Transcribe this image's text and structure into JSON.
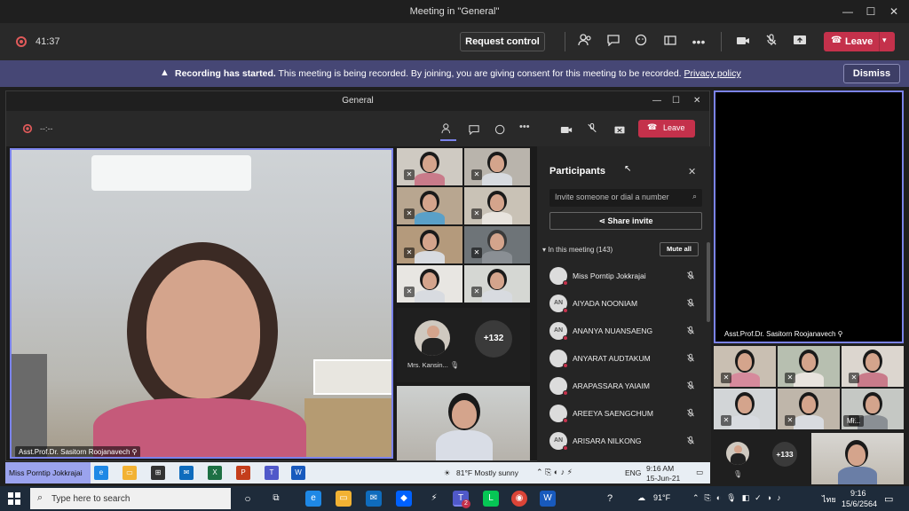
{
  "window": {
    "title": "Meeting in \"General\"",
    "minimize": "—",
    "maximize": "☐",
    "close": "✕"
  },
  "meeting_bar": {
    "elapsed": "41:37",
    "request_control": "Request control",
    "leave": "Leave"
  },
  "banner": {
    "bold": "Recording has started.",
    "text": " This meeting is being recorded. By joining, you are giving consent for this meeting to be recorded. ",
    "link": "Privacy policy",
    "dismiss": "Dismiss"
  },
  "inner": {
    "title": "General",
    "timer": "--:--",
    "leave": "Leave",
    "main_speaker": "Asst.Prof.Dr. Sasitorn Roojanavech",
    "kansin": "Mrs. Kansin...",
    "overflow": "+132"
  },
  "panel": {
    "title": "Participants",
    "search_placeholder": "Invite someone or dial a number",
    "share_invite": "Share invite",
    "section": "In this meeting (143)",
    "mute_all": "Mute all",
    "participants": [
      {
        "initials": "",
        "name": "Miss Porntip Jokkrajai"
      },
      {
        "initials": "AN",
        "name": "AIYADA NOONIAM"
      },
      {
        "initials": "AN",
        "name": "ANANYA NUANSAENG"
      },
      {
        "initials": "",
        "name": "ANYARAT AUDTAKUM"
      },
      {
        "initials": "",
        "name": "ARAPASSARA YAIAIM"
      },
      {
        "initials": "",
        "name": "AREEYA SAENGCHUM"
      },
      {
        "initials": "AN",
        "name": "ARISARA NILKONG"
      }
    ]
  },
  "right_stage": {
    "speaker": "Asst.Prof.Dr. Sasitorn Roojanavech",
    "mi_label": "Mi...",
    "overflow": "+133"
  },
  "inner_taskbar": {
    "presenter": "Miss Porntip Jokkrajai",
    "weather": "81°F  Mostly sunny",
    "lang": "ENG",
    "time": "9:16 AM",
    "date": "15-Jun-21"
  },
  "taskbar": {
    "search_placeholder": "Type here to search",
    "weather": "91°F",
    "lang": "ไทย",
    "time": "9:16",
    "date": "15/6/2564",
    "teams_badge": "2"
  }
}
